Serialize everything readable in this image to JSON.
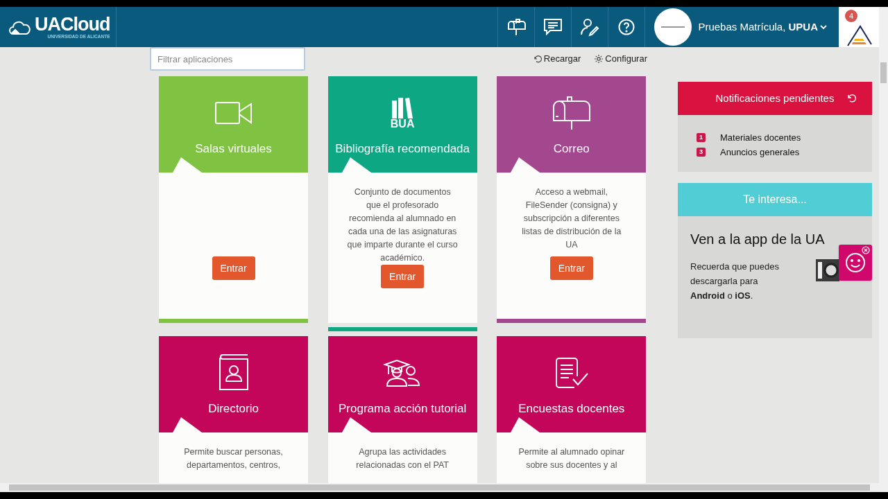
{
  "header": {
    "logo": {
      "name": "UACloud",
      "subtitle": "UNIVERSIDAD DE ALICANTE"
    },
    "tools": [
      {
        "kind": "mailbox"
      },
      {
        "kind": "chat"
      },
      {
        "kind": "user-edit"
      },
      {
        "kind": "help"
      }
    ],
    "user": {
      "name": "Pruebas Matrícula, **UPUA**"
    },
    "notification_count": "4"
  },
  "toolbar": {
    "filter": {
      "placeholder": "Filtrar aplicaciones"
    },
    "actions": [
      {
        "kind": "reload",
        "label": "Recargar"
      },
      {
        "kind": "settings",
        "label": "Configurar"
      }
    ]
  },
  "apps": [
    {
      "title": "Salas virtuales",
      "kind": "video",
      "color": "#80c342",
      "button": "Entrar"
    },
    {
      "title": "Bibliografía recomendada",
      "kind": "books",
      "icon_label": "BUA",
      "color": "#0ea784",
      "description": "Conjunto de documentos que el profesorado recomienda al alumnado en cada una de las asignaturas que imparte durante el curso académico.",
      "button": "Entrar"
    },
    {
      "title": "Correo",
      "kind": "mailbox",
      "color": "#a3478f",
      "description": "Acceso a webmail, FileSender (consigna) y subscripción a diferentes listas de distribución de la UA",
      "button": "Entrar"
    },
    {
      "title": "Directorio",
      "kind": "contact-book",
      "color": "#c4065a",
      "description": "Permite buscar personas, departamentos, centros,"
    },
    {
      "title": "Programa acción tutorial",
      "kind": "graduates",
      "color": "#c4065a",
      "description": "Agrupa las actividades relacionadas con el PAT"
    },
    {
      "title": "Encuestas docentes",
      "kind": "survey",
      "color": "#c4065a",
      "description": "Permite al alumnado opinar sobre sus docentes y al"
    }
  ],
  "notifications": {
    "title": "Notificaciones pendientes",
    "items": [
      {
        "count": "1",
        "label": "Materiales docentes"
      },
      {
        "count": "3",
        "label": "Anuncios generales"
      }
    ]
  },
  "interest": {
    "title": "Te interesa...",
    "heading": "Ven a la app de la UA",
    "text": "Recuerda que puedes descargarla para **Android** o **iOS**."
  }
}
